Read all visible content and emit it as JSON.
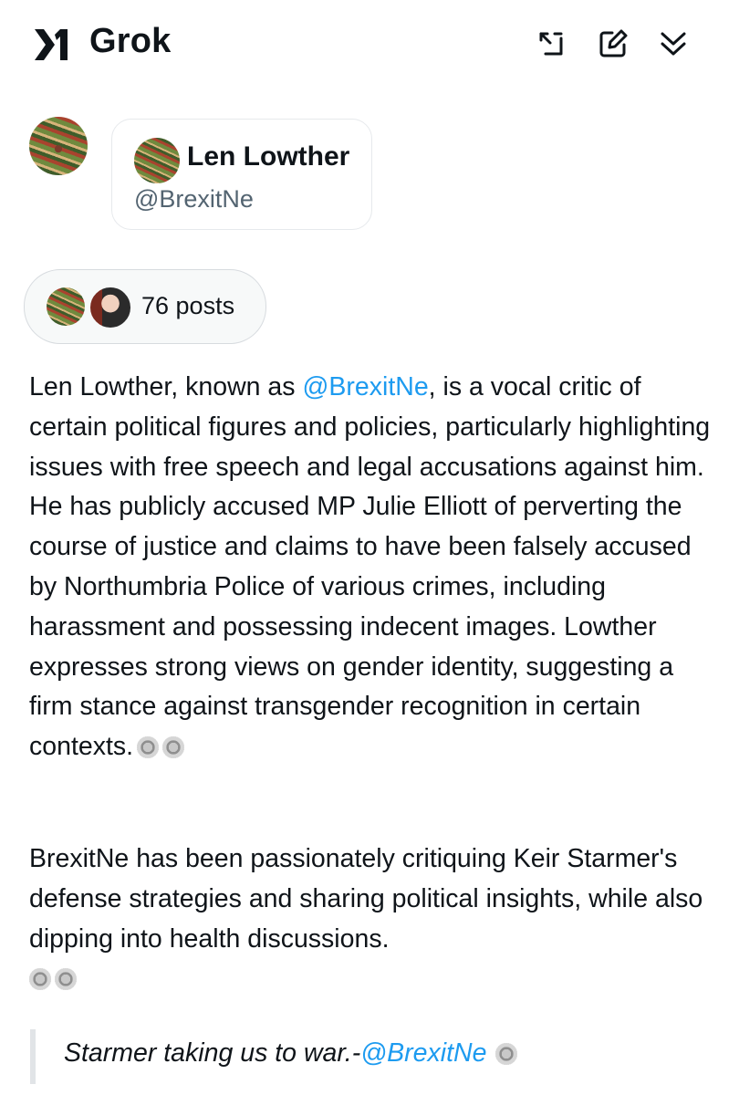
{
  "app": {
    "title": "Grok"
  },
  "profile_card": {
    "name": "Len Lowther",
    "handle": "@BrexitNe"
  },
  "posts_pill": {
    "label": "76 posts"
  },
  "summary": {
    "p1_before": "Len Lowther, known as ",
    "p1_mention": "@BrexitNe",
    "p1_after": ", is a vocal critic of certain political figures and policies, particularly highlighting issues with free speech and legal accusations against him. He has publicly accused MP Julie Elliott of perverting the course of justice and claims to have been falsely accused by Northumbria Police of various crimes, including harassment and possessing indecent images. Lowther expresses strong views on gender identity, suggesting a firm stance against transgender recognition in certain contexts.",
    "p2": "BrexitNe has been passionately critiquing Keir Starmer's defense strategies and sharing political insights, while also dipping into health discussions."
  },
  "quote": {
    "text": "Starmer taking us to war.-",
    "mention": "@BrexitNe"
  },
  "icons": [
    "x-ai-logo",
    "expand-icon",
    "new-chat-icon",
    "collapse-icon",
    "citation-icon"
  ],
  "colors": {
    "link": "#1d9bf0",
    "text": "#0f1419",
    "muted": "#536471"
  }
}
